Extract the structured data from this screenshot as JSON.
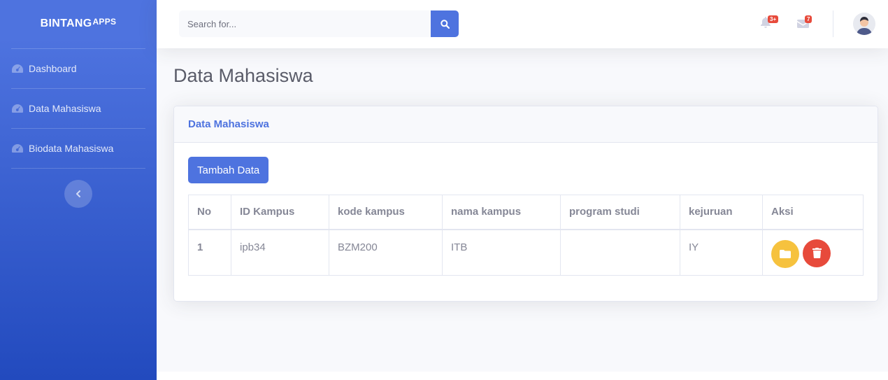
{
  "sidebar": {
    "brand_name": "BINTANG",
    "brand_suffix": "APPS",
    "items": [
      {
        "label": "Dashboard",
        "icon": "tachometer-icon"
      },
      {
        "label": "Data Mahasiswa",
        "icon": "tachometer-icon"
      },
      {
        "label": "Biodata Mahasiswa",
        "icon": "tachometer-icon"
      }
    ],
    "toggle_icon": "chevron-left-icon"
  },
  "topbar": {
    "search_placeholder": "Search for...",
    "alerts_badge": "3+",
    "messages_badge": "7"
  },
  "page": {
    "title": "Data Mahasiswa"
  },
  "card": {
    "header": "Data Mahasiswa",
    "add_button": "Tambah Data",
    "table": {
      "columns": [
        "No",
        "ID Kampus",
        "kode kampus",
        "nama kampus",
        "program studi",
        "kejuruan",
        "Aksi"
      ],
      "rows": [
        {
          "no": "1",
          "id_kampus": "ipb34",
          "kode_kampus": "BZM200",
          "nama_kampus": "ITB",
          "program_studi": "",
          "kejuruan": "IY"
        }
      ]
    }
  },
  "colors": {
    "primary": "#4e73df",
    "warning": "#f6c23e",
    "danger": "#e74a3b"
  }
}
